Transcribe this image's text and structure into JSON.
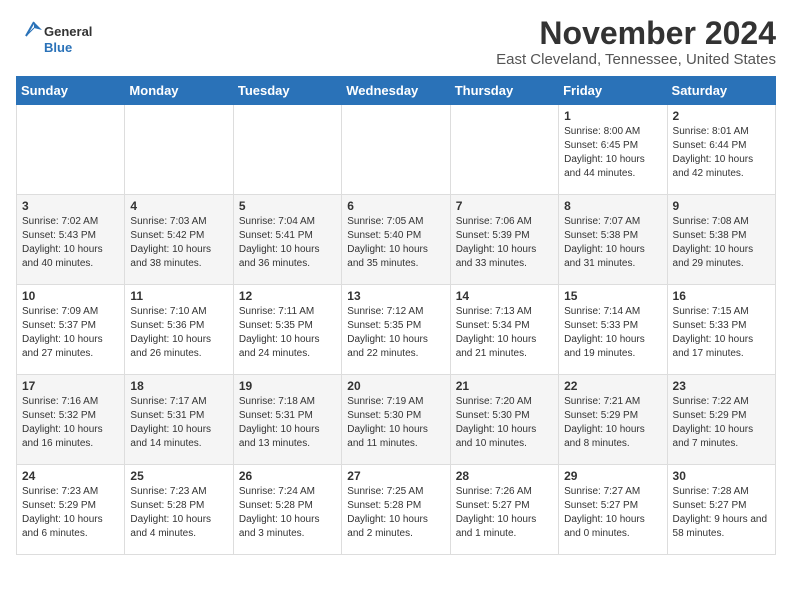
{
  "logo": {
    "text_general": "General",
    "text_blue": "Blue"
  },
  "header": {
    "month": "November 2024",
    "location": "East Cleveland, Tennessee, United States"
  },
  "weekdays": [
    "Sunday",
    "Monday",
    "Tuesday",
    "Wednesday",
    "Thursday",
    "Friday",
    "Saturday"
  ],
  "weeks": [
    [
      {
        "day": "",
        "content": ""
      },
      {
        "day": "",
        "content": ""
      },
      {
        "day": "",
        "content": ""
      },
      {
        "day": "",
        "content": ""
      },
      {
        "day": "",
        "content": ""
      },
      {
        "day": "1",
        "content": "Sunrise: 8:00 AM\nSunset: 6:45 PM\nDaylight: 10 hours and 44 minutes."
      },
      {
        "day": "2",
        "content": "Sunrise: 8:01 AM\nSunset: 6:44 PM\nDaylight: 10 hours and 42 minutes."
      }
    ],
    [
      {
        "day": "3",
        "content": "Sunrise: 7:02 AM\nSunset: 5:43 PM\nDaylight: 10 hours and 40 minutes."
      },
      {
        "day": "4",
        "content": "Sunrise: 7:03 AM\nSunset: 5:42 PM\nDaylight: 10 hours and 38 minutes."
      },
      {
        "day": "5",
        "content": "Sunrise: 7:04 AM\nSunset: 5:41 PM\nDaylight: 10 hours and 36 minutes."
      },
      {
        "day": "6",
        "content": "Sunrise: 7:05 AM\nSunset: 5:40 PM\nDaylight: 10 hours and 35 minutes."
      },
      {
        "day": "7",
        "content": "Sunrise: 7:06 AM\nSunset: 5:39 PM\nDaylight: 10 hours and 33 minutes."
      },
      {
        "day": "8",
        "content": "Sunrise: 7:07 AM\nSunset: 5:38 PM\nDaylight: 10 hours and 31 minutes."
      },
      {
        "day": "9",
        "content": "Sunrise: 7:08 AM\nSunset: 5:38 PM\nDaylight: 10 hours and 29 minutes."
      }
    ],
    [
      {
        "day": "10",
        "content": "Sunrise: 7:09 AM\nSunset: 5:37 PM\nDaylight: 10 hours and 27 minutes."
      },
      {
        "day": "11",
        "content": "Sunrise: 7:10 AM\nSunset: 5:36 PM\nDaylight: 10 hours and 26 minutes."
      },
      {
        "day": "12",
        "content": "Sunrise: 7:11 AM\nSunset: 5:35 PM\nDaylight: 10 hours and 24 minutes."
      },
      {
        "day": "13",
        "content": "Sunrise: 7:12 AM\nSunset: 5:35 PM\nDaylight: 10 hours and 22 minutes."
      },
      {
        "day": "14",
        "content": "Sunrise: 7:13 AM\nSunset: 5:34 PM\nDaylight: 10 hours and 21 minutes."
      },
      {
        "day": "15",
        "content": "Sunrise: 7:14 AM\nSunset: 5:33 PM\nDaylight: 10 hours and 19 minutes."
      },
      {
        "day": "16",
        "content": "Sunrise: 7:15 AM\nSunset: 5:33 PM\nDaylight: 10 hours and 17 minutes."
      }
    ],
    [
      {
        "day": "17",
        "content": "Sunrise: 7:16 AM\nSunset: 5:32 PM\nDaylight: 10 hours and 16 minutes."
      },
      {
        "day": "18",
        "content": "Sunrise: 7:17 AM\nSunset: 5:31 PM\nDaylight: 10 hours and 14 minutes."
      },
      {
        "day": "19",
        "content": "Sunrise: 7:18 AM\nSunset: 5:31 PM\nDaylight: 10 hours and 13 minutes."
      },
      {
        "day": "20",
        "content": "Sunrise: 7:19 AM\nSunset: 5:30 PM\nDaylight: 10 hours and 11 minutes."
      },
      {
        "day": "21",
        "content": "Sunrise: 7:20 AM\nSunset: 5:30 PM\nDaylight: 10 hours and 10 minutes."
      },
      {
        "day": "22",
        "content": "Sunrise: 7:21 AM\nSunset: 5:29 PM\nDaylight: 10 hours and 8 minutes."
      },
      {
        "day": "23",
        "content": "Sunrise: 7:22 AM\nSunset: 5:29 PM\nDaylight: 10 hours and 7 minutes."
      }
    ],
    [
      {
        "day": "24",
        "content": "Sunrise: 7:23 AM\nSunset: 5:29 PM\nDaylight: 10 hours and 6 minutes."
      },
      {
        "day": "25",
        "content": "Sunrise: 7:23 AM\nSunset: 5:28 PM\nDaylight: 10 hours and 4 minutes."
      },
      {
        "day": "26",
        "content": "Sunrise: 7:24 AM\nSunset: 5:28 PM\nDaylight: 10 hours and 3 minutes."
      },
      {
        "day": "27",
        "content": "Sunrise: 7:25 AM\nSunset: 5:28 PM\nDaylight: 10 hours and 2 minutes."
      },
      {
        "day": "28",
        "content": "Sunrise: 7:26 AM\nSunset: 5:27 PM\nDaylight: 10 hours and 1 minute."
      },
      {
        "day": "29",
        "content": "Sunrise: 7:27 AM\nSunset: 5:27 PM\nDaylight: 10 hours and 0 minutes."
      },
      {
        "day": "30",
        "content": "Sunrise: 7:28 AM\nSunset: 5:27 PM\nDaylight: 9 hours and 58 minutes."
      }
    ]
  ]
}
